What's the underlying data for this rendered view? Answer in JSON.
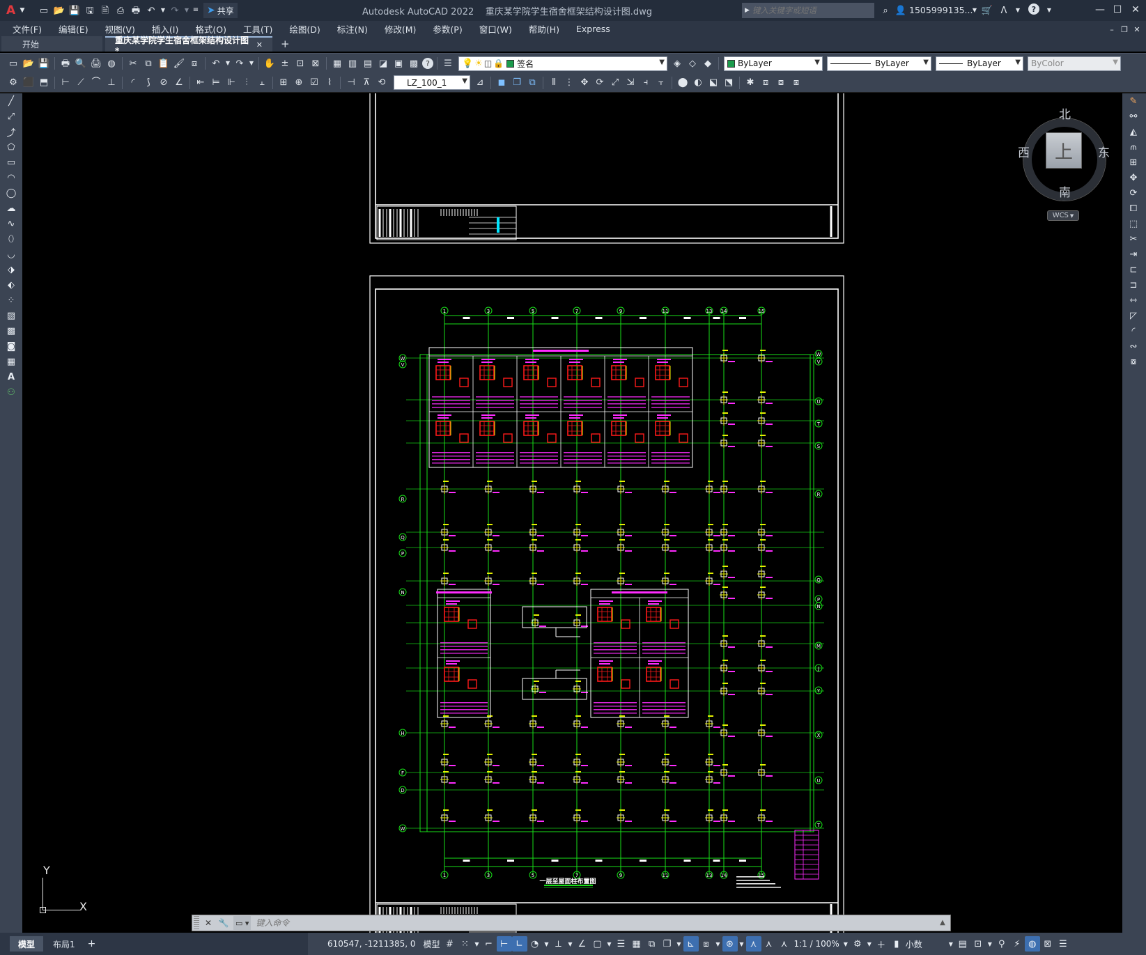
{
  "window": {
    "app_name": "Autodesk AutoCAD 2022",
    "file_name": "重庆某学院学生宿舍框架结构设计图.dwg",
    "search_placeholder": "键入关键字或短语",
    "user": "1505999135...",
    "share": "共享",
    "logo": "A"
  },
  "menu": [
    "文件(F)",
    "编辑(E)",
    "视图(V)",
    "插入(I)",
    "格式(O)",
    "工具(T)",
    "绘图(D)",
    "标注(N)",
    "修改(M)",
    "参数(P)",
    "窗口(W)",
    "帮助(H)",
    "Express"
  ],
  "tabs": {
    "start": "开始",
    "active": "重庆某学院学生宿舍框架结构设计图*",
    "add": "+",
    "close": "✕"
  },
  "toolbar": {
    "layer": "签名",
    "color": "ByLayer",
    "linetype": "ByLayer",
    "lineweight": "ByLayer",
    "plotstyle": "ByColor",
    "dimstyle": "LZ_100_1"
  },
  "viewcube": {
    "north": "北",
    "south": "南",
    "east": "东",
    "west": "西",
    "face": "上",
    "wcs": "WCS"
  },
  "ucs": {
    "x": "X",
    "y": "Y"
  },
  "drawing": {
    "title": "一层至屋面柱布置图",
    "grid_top": [
      "1",
      "3",
      "5",
      "7",
      "9",
      "11",
      "13",
      "14",
      "15"
    ],
    "grid_left": [
      "W",
      "V",
      "R",
      "Q",
      "P",
      "N",
      "H",
      "F",
      "D"
    ],
    "grid_right": [
      "W",
      "V",
      "U",
      "T",
      "S",
      "R",
      "Q",
      "P",
      "N",
      "M",
      "J",
      "Y",
      "X",
      "U",
      "T",
      "S",
      "M",
      "G",
      "C"
    ]
  },
  "command": {
    "placeholder": "键入命令"
  },
  "layout_tabs": {
    "model": "模型",
    "layout1": "布局1",
    "add": "+"
  },
  "status": {
    "coords": "610547, -1211385, 0",
    "mode": "模型",
    "scale": "1:1 / 100%",
    "units": "小数"
  }
}
